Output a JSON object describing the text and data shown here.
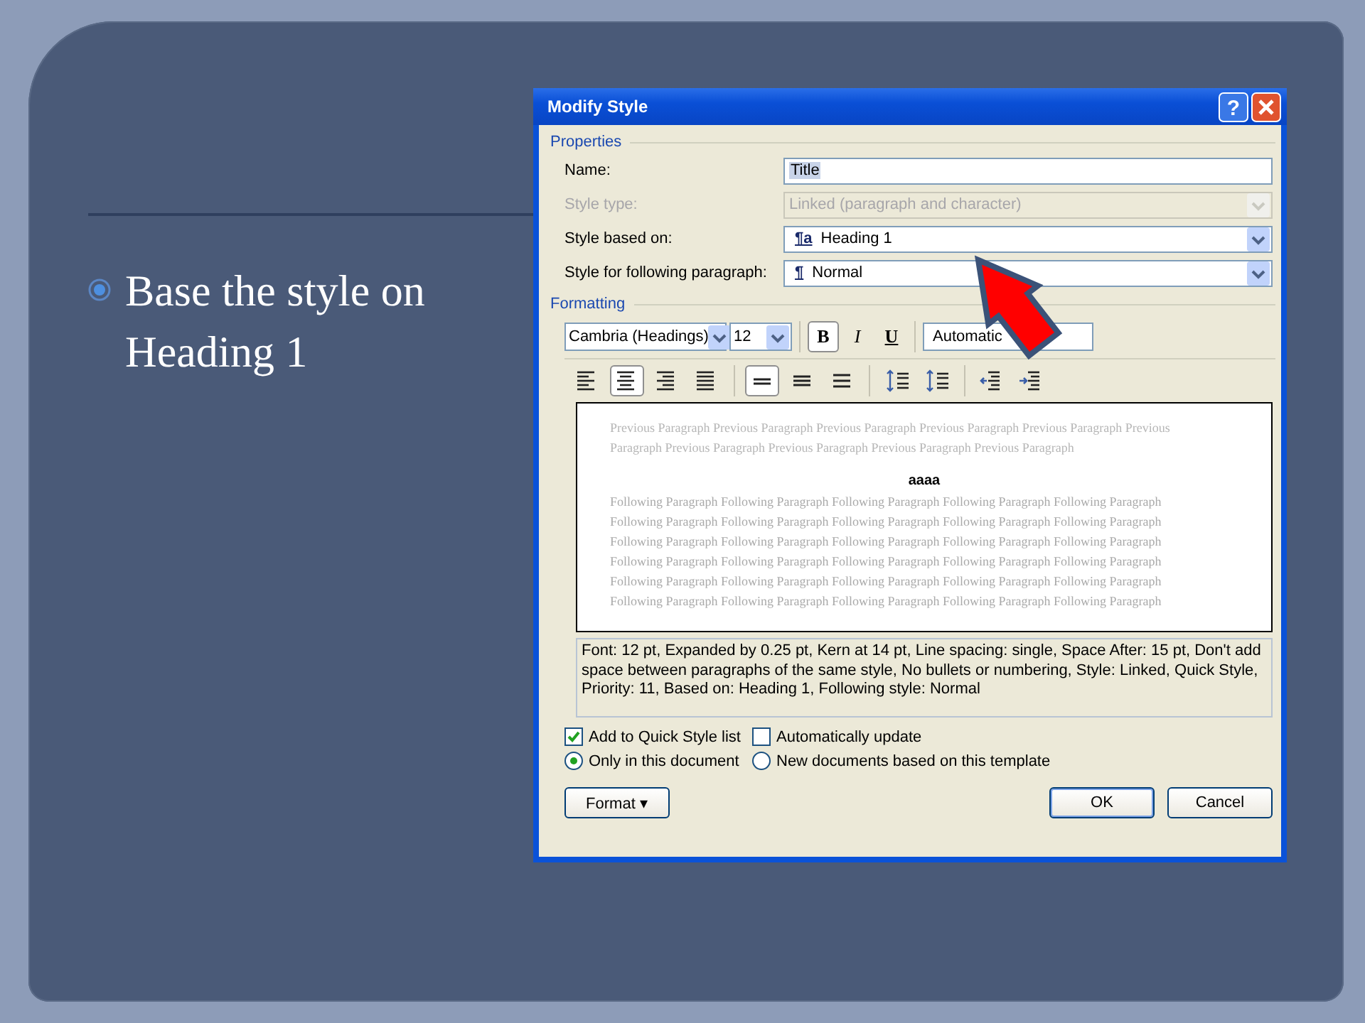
{
  "slide": {
    "bullet": {
      "text": "Base the style on Heading 1"
    }
  },
  "dialog": {
    "title": "Modify Style",
    "help_glyph": "?",
    "properties_label": "Properties",
    "fields": [
      {
        "label": "Name:",
        "kind": "text",
        "value": "Title",
        "disabled": false
      },
      {
        "label": "Style type:",
        "kind": "select",
        "value": "Linked (paragraph and character)",
        "disabled": true
      },
      {
        "label": "Style based on:",
        "kind": "select",
        "glyph": "¶a",
        "value": "Heading 1",
        "disabled": false
      },
      {
        "label": "Style for following paragraph:",
        "kind": "select",
        "glyph": "¶",
        "value": "Normal",
        "disabled": false
      }
    ],
    "formatting_label": "Formatting",
    "font": "Cambria (Headings)",
    "size": "12",
    "styles": [
      {
        "text": "B",
        "kind": "bold",
        "selected": true
      },
      {
        "text": "I",
        "kind": "italic",
        "selected": false
      },
      {
        "text": "U",
        "kind": "underline",
        "selected": false
      }
    ],
    "font_color_label": "Automatic",
    "paragraph_tools": [
      {
        "kind": "align-left",
        "selected": false
      },
      {
        "kind": "align-center",
        "selected": true
      },
      {
        "kind": "align-right",
        "selected": false
      },
      {
        "kind": "justify",
        "selected": false
      },
      {
        "kind": "single-spacing",
        "selected": true
      },
      {
        "kind": "one-half-spacing",
        "selected": false
      },
      {
        "kind": "double-spacing",
        "selected": false
      },
      {
        "kind": "space-before",
        "selected": false
      },
      {
        "kind": "space-after",
        "selected": false
      },
      {
        "kind": "outdent",
        "selected": false
      },
      {
        "kind": "indent",
        "selected": false
      }
    ],
    "preview": {
      "previous": [
        "Previous Paragraph Previous Paragraph Previous Paragraph Previous Paragraph Previous Paragraph Previous",
        "Paragraph Previous Paragraph Previous Paragraph Previous Paragraph Previous Paragraph"
      ],
      "sample": "aaaa",
      "following": [
        "Following Paragraph Following Paragraph Following Paragraph Following Paragraph Following Paragraph",
        "Following Paragraph Following Paragraph Following Paragraph Following Paragraph Following Paragraph",
        "Following Paragraph Following Paragraph Following Paragraph Following Paragraph Following Paragraph",
        "Following Paragraph Following Paragraph Following Paragraph Following Paragraph Following Paragraph",
        "Following Paragraph Following Paragraph Following Paragraph Following Paragraph Following Paragraph",
        "Following Paragraph Following Paragraph Following Paragraph Following Paragraph Following Paragraph"
      ]
    },
    "description": "Font: 12 pt, Expanded by  0.25 pt, Kern at 14 pt, Line spacing:  single, Space After:  15 pt, Don't add space between paragraphs of the same style,  No bullets or numbering, Style: Linked, Quick Style, Priority: 11, Based on: Heading 1, Following style: Normal",
    "checkboxes": [
      {
        "label": "Add to Quick Style list",
        "checked": true
      },
      {
        "label": "Automatically update",
        "checked": false
      }
    ],
    "radios": [
      {
        "label": "Only in this document",
        "selected": true
      },
      {
        "label": "New documents based on this template",
        "selected": false
      }
    ],
    "format_button": {
      "label": "Format",
      "caret": "▾"
    },
    "buttons": [
      {
        "label": "OK",
        "kind": "default"
      },
      {
        "label": "Cancel",
        "kind": "normal"
      }
    ]
  }
}
